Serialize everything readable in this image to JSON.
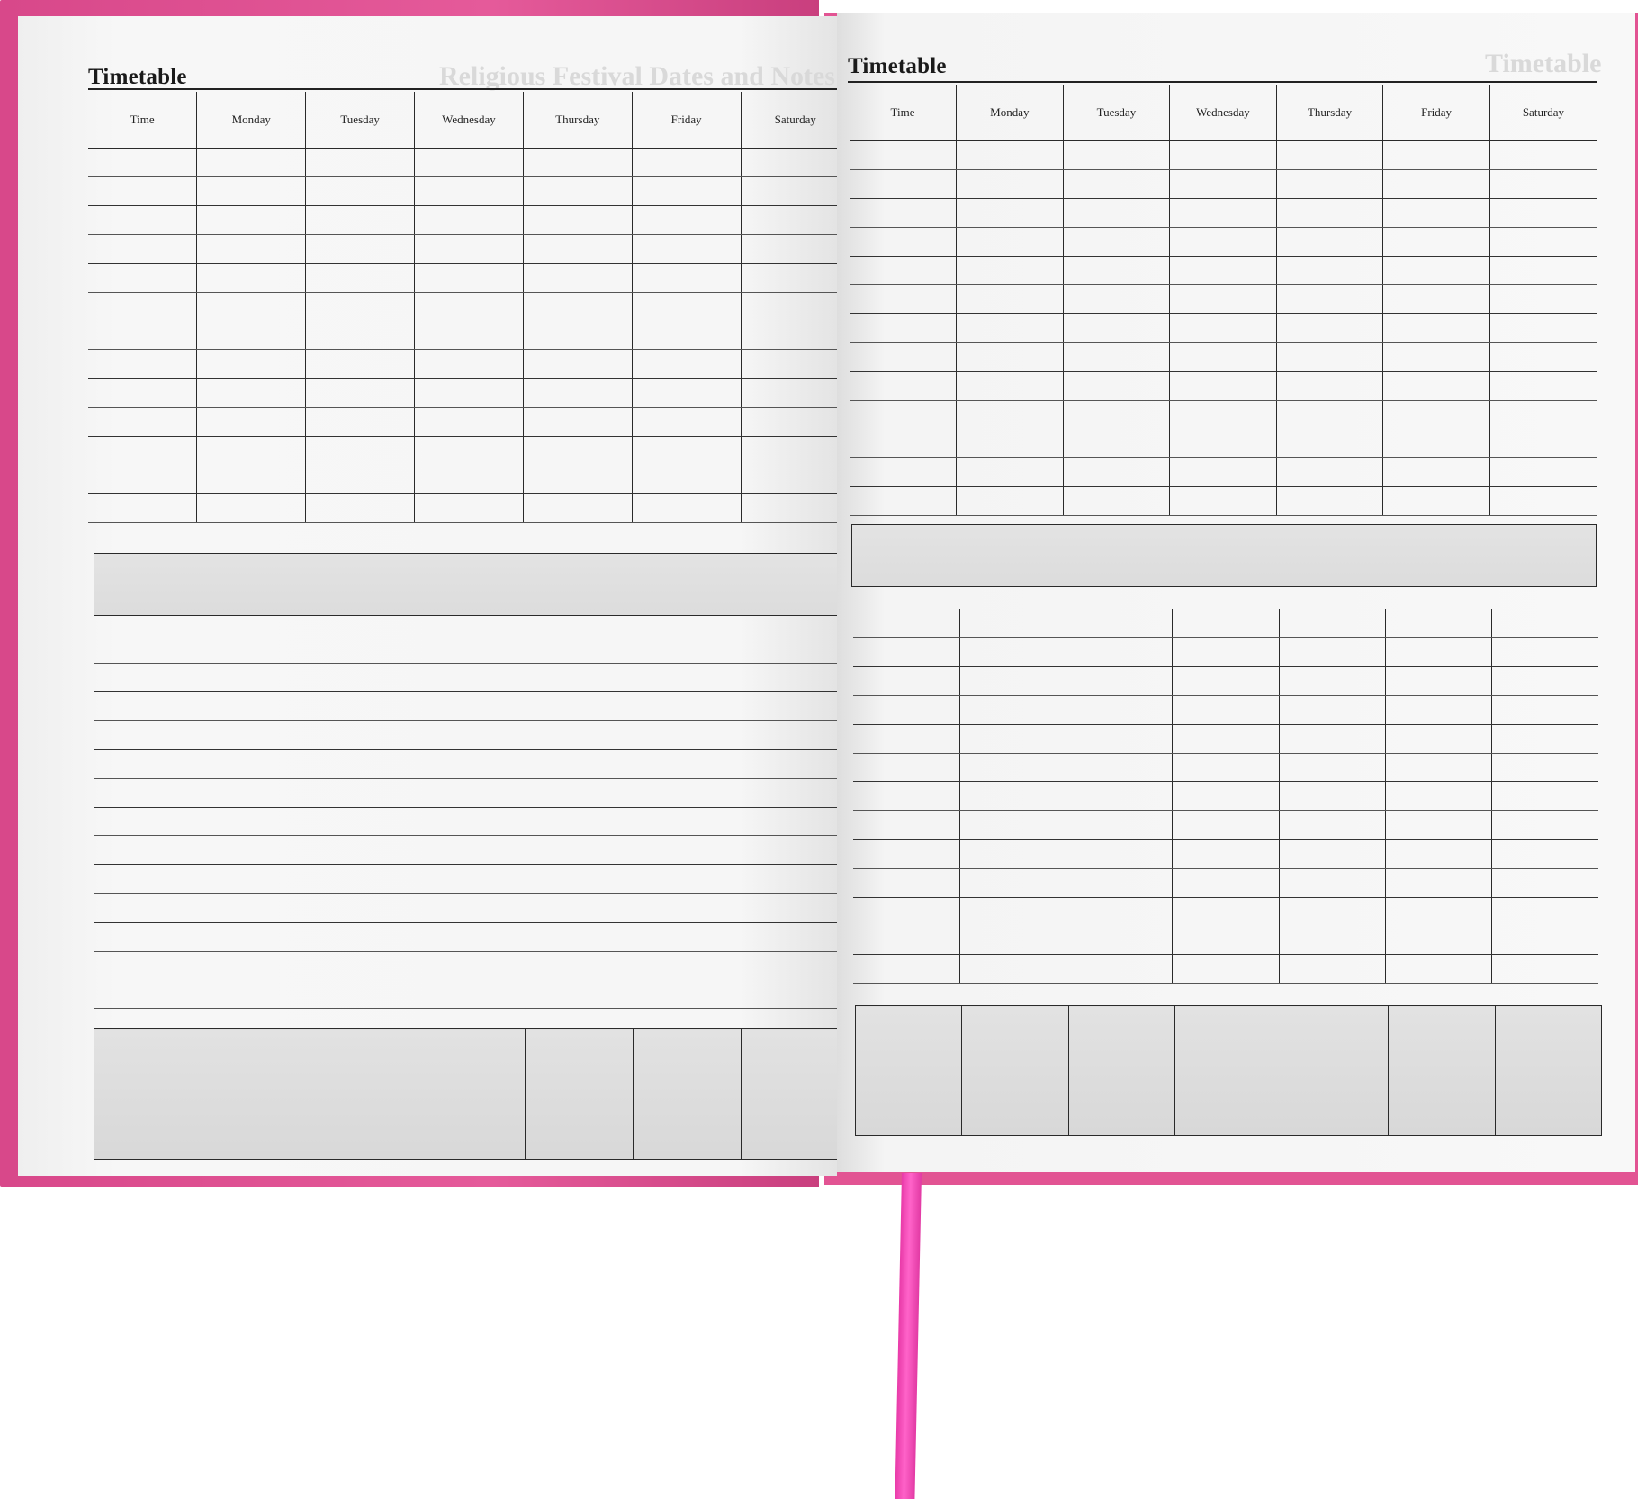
{
  "colors": {
    "cover": "#e25493",
    "ribbon": "#f04fbf",
    "page": "#f6f6f6"
  },
  "left_page": {
    "title": "Timetable",
    "ghost_title": "Religious Festival Dates and Notes",
    "columns": [
      "Time",
      "Monday",
      "Tuesday",
      "Wednesday",
      "Thursday",
      "Friday",
      "Saturday"
    ]
  },
  "right_page": {
    "title": "Timetable",
    "ghost_title": "Timetable",
    "columns": [
      "Time",
      "Monday",
      "Tuesday",
      "Wednesday",
      "Thursday",
      "Friday",
      "Saturday"
    ]
  }
}
